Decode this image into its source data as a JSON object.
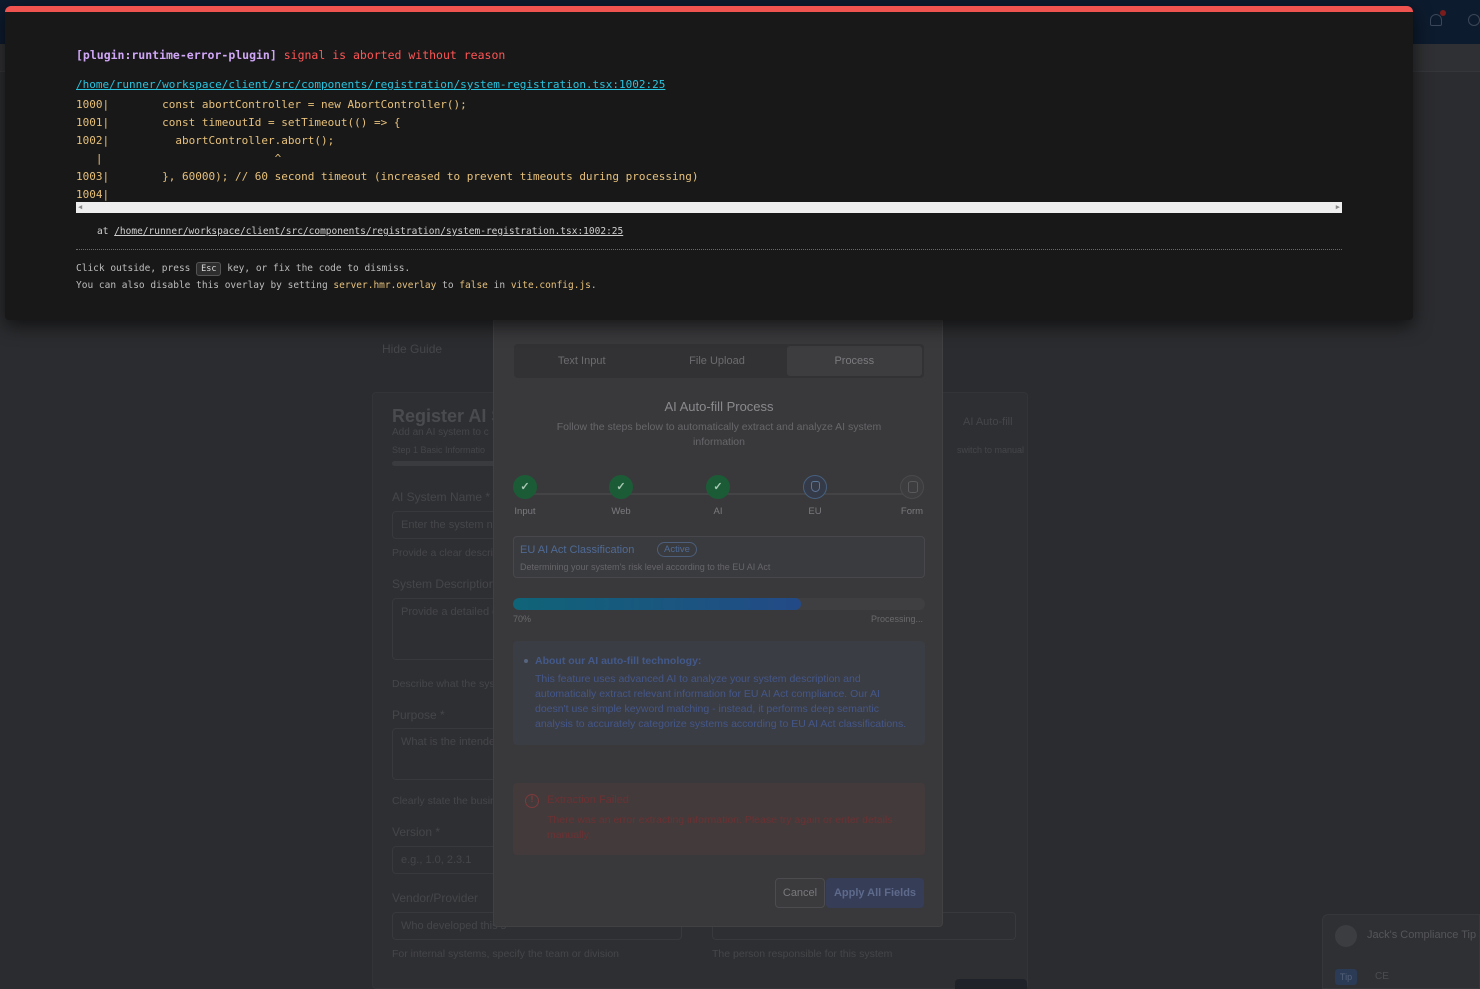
{
  "overlay": {
    "plugin": "[plugin:runtime-error-plugin]",
    "message": "signal is aborted without reason",
    "file_link": "/home/runner/workspace/client/src/components/registration/system-registration.tsx:1002:25",
    "code_frame": "1000|        const abortController = new AbortController();\n1001|        const timeoutId = setTimeout(() => {\n1002|          abortController.abort();\n   |                          ^\n1003|        }, 60000); // 60 second timeout (increased to prevent timeouts during processing)\n1004|",
    "stack_prefix": "at",
    "stack_link": "/home/runner/workspace/client/src/components/registration/system-registration.tsx:1002:25",
    "tip1_before": "Click outside, press",
    "tip1_key": "Esc",
    "tip1_after": "key, or fix the code to dismiss.",
    "tip2_before": "You can also disable this overlay by setting",
    "tip2_code1": "server.hmr.overlay",
    "tip2_to": "to",
    "tip2_code2": "false",
    "tip2_in": "in",
    "tip2_code3": "vite.config.js",
    "tip2_end": "."
  },
  "background": {
    "hide_guide": "Hide Guide",
    "card_title": "Register AI Sy",
    "card_subtitle": "Add an AI system to c",
    "step_info": "Step 1 Basic Informatio",
    "ai_autofill": "AI Auto-fill",
    "switch_manual": "switch to manual",
    "field_name_label": "AI System Name *",
    "field_name_placeholder": "Enter the system na",
    "field_name_help": "Provide a clear descri",
    "field_desc_label": "System Description *",
    "field_desc_placeholder": "Provide a detailed d",
    "field_desc_help": "Describe what the sys",
    "field_purpose_label": "Purpose *",
    "field_purpose_placeholder": "What is the intende",
    "field_purpose_help": "Clearly state the busin",
    "field_version_label": "Version *",
    "field_version_placeholder": "e.g., 1.0, 2.3.1",
    "field_vendor_label": "Vendor/Provider",
    "field_vendor_placeholder": "Who developed this s",
    "field_vendor_help": "For internal systems, specify the team or division",
    "field_owner_help": "The person responsible for this system",
    "tip_title": "Jack's Compliance Tip",
    "tip_chip": "Tip",
    "tip_ce": "CE"
  },
  "modal": {
    "tabs": [
      "Text Input",
      "File Upload",
      "Process"
    ],
    "active_tab": 2,
    "title": "AI Auto-fill Process",
    "subtitle": "Follow the steps below to automatically extract and analyze AI system information",
    "steps": [
      {
        "label": "Input",
        "state": "done"
      },
      {
        "label": "Web",
        "state": "done"
      },
      {
        "label": "AI",
        "state": "done"
      },
      {
        "label": "EU",
        "state": "active"
      },
      {
        "label": "Form",
        "state": "idle"
      }
    ],
    "current_step": {
      "title": "EU AI Act Classification",
      "badge": "Active",
      "description": "Determining your system's risk level according to the EU AI Act"
    },
    "progress": {
      "value_pct": 70,
      "label": "70%",
      "status": "Processing..."
    },
    "info": {
      "heading": "About our AI auto-fill technology:",
      "body": "This feature uses advanced AI to analyze your system description and automatically extract relevant information for EU AI Act compliance. Our AI doesn't use simple keyword matching - instead, it performs deep semantic analysis to accurately categorize systems according to EU AI Act classifications."
    },
    "error": {
      "heading": "Extraction Failed",
      "body": "There was an error extracting information. Please try again or enter details manually."
    },
    "buttons": {
      "cancel": "Cancel",
      "apply": "Apply All Fields"
    }
  }
}
